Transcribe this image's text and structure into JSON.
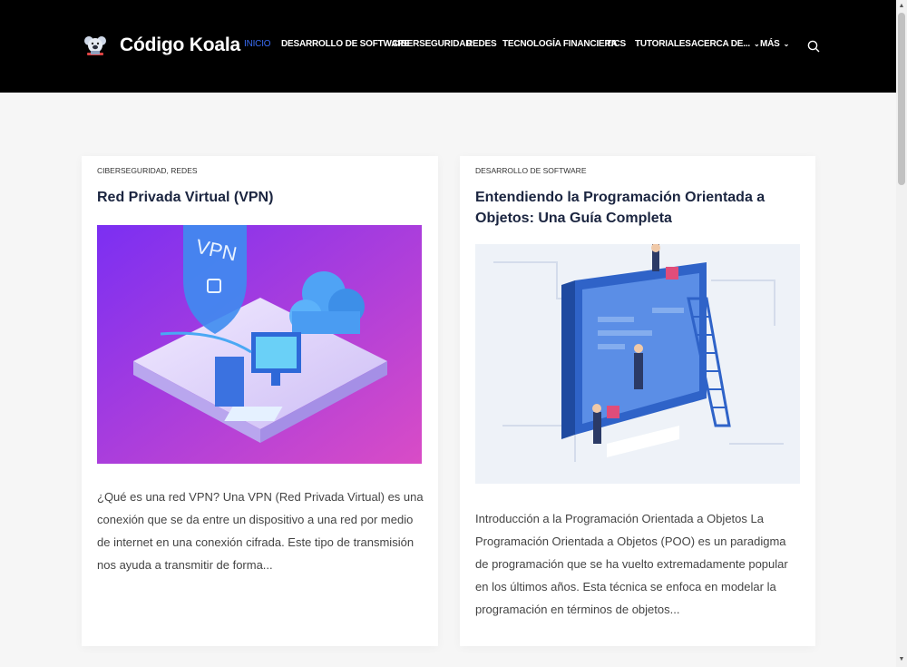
{
  "site": {
    "brand": "Código Koala"
  },
  "nav": {
    "items": [
      {
        "label": "INICIO"
      },
      {
        "label": "DESARROLLO DE SOFTWARE"
      },
      {
        "label": "CIBERSEGURIDAD"
      },
      {
        "label": "REDES"
      },
      {
        "label": "TECNOLOGÍA FINANCIERA"
      },
      {
        "label": "TICS"
      },
      {
        "label": "TUTORIALES"
      },
      {
        "label": "ACERCA DE..."
      },
      {
        "label": "MÁS"
      }
    ],
    "chevron": "⌄"
  },
  "posts": [
    {
      "categories": [
        "CIBERSEGURIDAD",
        "REDES"
      ],
      "separator": ", ",
      "title": "Red Privada Virtual (VPN)",
      "image_text": "VPN",
      "excerpt": "¿Qué es una red VPN? Una VPN (Red Privada Virtual) es una conexión que se da entre un dispositivo a una red por medio de internet en una conexión cifrada. Este tipo de transmisión nos ayuda a transmitir de forma..."
    },
    {
      "categories": [
        "DESARROLLO DE SOFTWARE"
      ],
      "title": "Entendiendo la Programación Orientada a Objetos: Una Guía Completa",
      "excerpt": "Introducción a la Programación Orientada a Objetos La Programación Orientada a Objetos (POO) es un paradigma de programación que se ha vuelto extremadamente popular en los últimos años. Esta técnica se enfoca en modelar la programación en términos de objetos..."
    }
  ],
  "colors": {
    "header_bg": "#000000",
    "nav_active": "#3a6cf4",
    "title": "#1b2540"
  },
  "icons": {
    "search": "search-icon",
    "logo": "koala-logo"
  }
}
